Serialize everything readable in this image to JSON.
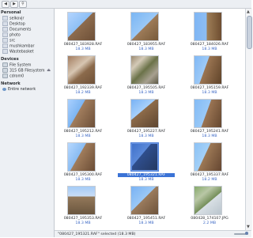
{
  "toolbar": {
    "back_symbol": "◀",
    "forward_symbol": "▶",
    "search_symbol": "⚲"
  },
  "sidebar": {
    "personal_title": "Personal",
    "personal": [
      "selkovjr",
      "Desktop",
      "Documents",
      "photo",
      "src",
      "mushkambar",
      "Wastebasket"
    ],
    "devices_title": "Devices",
    "devices": [
      "File System",
      "315 GB Filesystem",
      "cdrom0"
    ],
    "network_title": "Network",
    "network": [
      "Entire network"
    ]
  },
  "files": [
    {
      "name": "080427_183928.RAF",
      "size": "18.3 MB"
    },
    {
      "name": "080427_183955.RAF",
      "size": "18.3 MB"
    },
    {
      "name": "080427_184026.RAF",
      "size": "18.3 MB"
    },
    {
      "name": "080427_192339.RAF",
      "size": "18.2 MB"
    },
    {
      "name": "080427_195505.RAF",
      "size": "18.3 MB"
    },
    {
      "name": "080427_195159.RAF",
      "size": "18.3 MB"
    },
    {
      "name": "080427_195212.RAF",
      "size": "18.3 MB"
    },
    {
      "name": "080427_195227.RAF",
      "size": "18.3 MB"
    },
    {
      "name": "080427_195241.RAF",
      "size": "18.3 MB"
    },
    {
      "name": "080427_195300.RAF",
      "size": "18.3 MB"
    },
    {
      "name": "080427_195321.RAF",
      "size": "18.3 MB"
    },
    {
      "name": "080427_195337.RAF",
      "size": "18.2 MB"
    },
    {
      "name": "080427_195353.RAF",
      "size": "18.3 MB"
    },
    {
      "name": "080427_195451.RAF",
      "size": "18.3 MB"
    },
    {
      "name": "080428_174107.JPG",
      "size": "2.2 MB"
    }
  ],
  "status": {
    "text": "\"080427_195321.RAF\" selected (18.3 MB)"
  },
  "colors": {
    "sky": "#7fb3ef",
    "rock": "#9b7a58",
    "selection": "#3b73d6"
  }
}
